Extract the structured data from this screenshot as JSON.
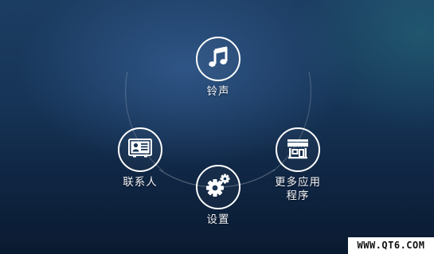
{
  "menu": {
    "ringtone": {
      "label": "铃声",
      "icon": "music-note-icon"
    },
    "contacts": {
      "label": "联系人",
      "icon": "contact-card-icon"
    },
    "more_apps": {
      "label": "更多应用\n程序",
      "icon": "store-icon"
    },
    "settings": {
      "label": "设置",
      "icon": "gears-icon"
    }
  },
  "watermark": "WWW.QT6.COM",
  "colors": {
    "background_top": "#1c3d62",
    "background_bottom": "#0a1a30",
    "icon_ring": "#ffffff",
    "label_text": "#f2f4f8",
    "watermark_bg": "#ffffff"
  }
}
